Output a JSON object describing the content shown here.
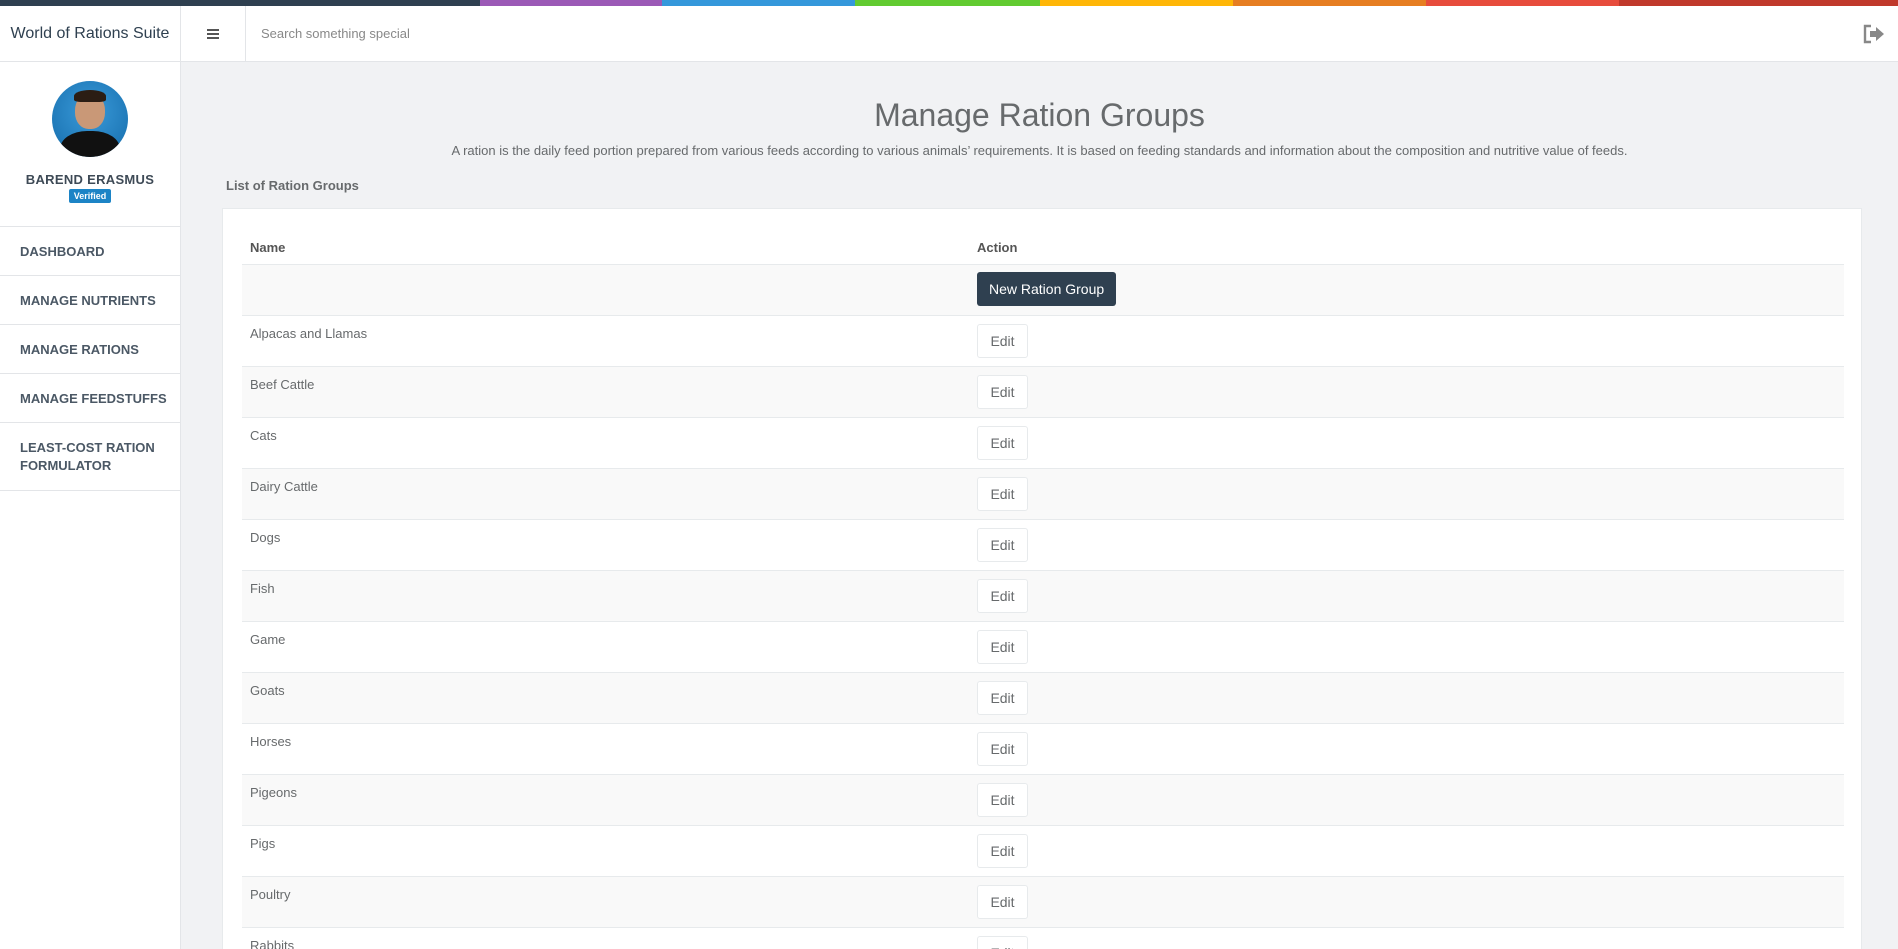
{
  "app": {
    "title": "World of Rations Suite"
  },
  "accent_colors": [
    "#2f4050",
    "#9b59b6",
    "#3498db",
    "#62cb31",
    "#ffb606",
    "#e67e22",
    "#e74c3c",
    "#c0392b"
  ],
  "search": {
    "placeholder": "Search something special"
  },
  "user": {
    "name": "BAREND ERASMUS",
    "badge": "Verified"
  },
  "sidebar": {
    "items": [
      {
        "label": "DASHBOARD"
      },
      {
        "label": "MANAGE NUTRIENTS"
      },
      {
        "label": "MANAGE RATIONS"
      },
      {
        "label": "MANAGE FEEDSTUFFS"
      },
      {
        "label": "LEAST-COST RATION FORMULATOR"
      }
    ]
  },
  "page": {
    "title": "Manage Ration Groups",
    "description": "A ration is the daily feed portion prepared from various feeds according to various animals’ requirements. It is based on feeding standards and information about the composition and nutritive value of feeds.",
    "section_label": "List of Ration Groups"
  },
  "table": {
    "headers": {
      "name": "Name",
      "action": "Action"
    },
    "new_button": "New Ration Group",
    "edit_label": "Edit",
    "rows": [
      "Alpacas and Llamas",
      "Beef Cattle",
      "Cats",
      "Dairy Cattle",
      "Dogs",
      "Fish",
      "Game",
      "Goats",
      "Horses",
      "Pigeons",
      "Pigs",
      "Poultry",
      "Rabbits"
    ]
  },
  "icons": {
    "menu": "hamburger-icon",
    "logout": "logout-icon"
  }
}
